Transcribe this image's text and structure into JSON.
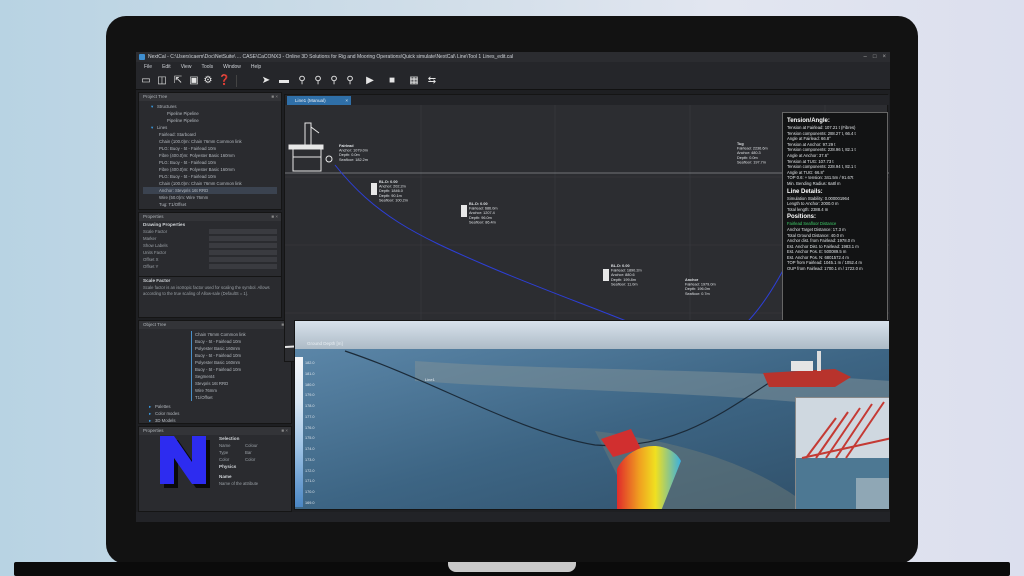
{
  "window": {
    "title": "NextCal - C:\\Users\\caem\\Doc\\NetSuite\\ ... CASE\\CaCONX3 - Online 3D Solutions for Rig and Mooring Operations\\Quick simulate\\NextCal\\ Line\\Tool 1 Lines_edit.cal",
    "controls": [
      "–",
      "□",
      "×"
    ]
  },
  "menu": [
    "File",
    "Edit",
    "View",
    "Tools",
    "Window",
    "Help"
  ],
  "toolbar_icons": [
    "new-file-icon",
    "open-file-icon",
    "import-icon",
    "export-icon",
    "settings-icon",
    "help-icon",
    "cursor-icon",
    "ruler-icon",
    "zoom-icon",
    "zoom-in-icon",
    "zoom-out-icon",
    "zoom-fit-icon",
    "play-icon",
    "stop-icon",
    "calculator-icon",
    "swap-icon"
  ],
  "project_tree": {
    "title": "Project Tree",
    "rows": [
      {
        "label": "Structures",
        "level": 1,
        "expanded": true
      },
      {
        "label": "Pipeline Pipeline",
        "level": 3
      },
      {
        "label": "Pipeline Pipeline",
        "level": 3
      },
      {
        "label": "Lines",
        "level": 1,
        "expanded": true
      },
      {
        "label": "Fairlead: Starboard",
        "level": 2
      },
      {
        "label": "Chain (100.0)m: Chain 76mm Common link",
        "level": 2
      },
      {
        "label": "PLG: Buoy - 5t - Fairlead 10m",
        "level": 2
      },
      {
        "label": "Fibre (400.0)m: Polyester Basic 160mm",
        "level": 2
      },
      {
        "label": "PLG: Buoy - 5t - Fairlead 10m",
        "level": 2
      },
      {
        "label": "Fibre (400.0)m: Polyester Basic 160mm",
        "level": 2
      },
      {
        "label": "PLG: Buoy - 5t - Fairlead 10m",
        "level": 2
      },
      {
        "label": "Chain (100.0)m: Chain 76mm Common link",
        "level": 2
      },
      {
        "label": "Anchor: Stevpris 16t RRD",
        "level": 2,
        "selected": true
      },
      {
        "label": "Wire (50.0)m: Wire 76mm",
        "level": 2
      },
      {
        "label": "Tug: T1/Offset",
        "level": 2
      }
    ]
  },
  "properties": {
    "title": "Properties",
    "section": "Drawing Properties",
    "rows": [
      "Scale Factor",
      "Marker",
      "Show Labels",
      "Units Factor",
      "Offset X",
      "Offset Y"
    ],
    "desc_title": "Scale Factor",
    "desc_text": "Scale factor is an isotropic factor used for scaling the symbol. Allows according to the true scaling of Allow-sale (DefaultS = 1)."
  },
  "object_tree": {
    "title": "Object Tree",
    "rows": [
      "Chain 76mm Common link",
      "Buoy - 5t - Fairlead 10m",
      "Polyester Basic 160mm",
      "Buoy - 5t - Fairlead 10m",
      "Polyester Basic 160mm",
      "Buoy - 5t - Fairlead 10m",
      "Segment4",
      "Stevpris 16t RRD",
      "Wire 76mm",
      "T1/Offset"
    ],
    "groups": [
      "Palettes",
      "Color modes",
      "3D Models",
      "Views"
    ]
  },
  "selection_panel": {
    "title": "Properties",
    "section": "Selection",
    "rows": [
      {
        "label": "Name",
        "value": "Colour"
      },
      {
        "label": "Type",
        "value": "Bar"
      },
      {
        "label": "Color",
        "value": "Color"
      }
    ],
    "section2": "Physics",
    "desc_title": "Name",
    "desc_text": "Name of the attribute"
  },
  "profile_view": {
    "tab_label": "Line1 (Manual)",
    "labels": {
      "fairlead": [
        "Fairlead",
        "Anchor: 1079.0m",
        "Depth: 0.0m",
        "Seafloor: 182.2m"
      ],
      "buoy1": [
        "BL.D: 0.00",
        "Anchor: 202.2m",
        "Depth: 1846.0",
        "Depth: 90.1m",
        "Seafloor: 100.2m"
      ],
      "buoy2": [
        "BL.D: 0.00",
        "Fairlead: 686.0m",
        "Anchor: 1207.4",
        "Depth: 96.0m",
        "Seafloor: 86.4m"
      ],
      "buoy3": [
        "BL.D: 0.00",
        "Fairlead: 1890.2m",
        "Anchor: 880.6",
        "Depth: 199.8m",
        "Seafloor: 11.0m"
      ],
      "anchor": [
        "Anchor",
        "Fairlead: 1979.0m",
        "Depth: 196.0m",
        "Seafloor: 0.7m"
      ],
      "tug": [
        "Tug",
        "Fairlead: 2236.6m",
        "Anchor: 480.3",
        "Depth: 0.0m",
        "Seafloor: 197.7m"
      ],
      "anchor_marker": "Anchor",
      "pipeline_marker": "Pipeline"
    }
  },
  "info_panel": {
    "title1": "Tension/Angle:",
    "rows1": [
      "Tension at Fairlead: 107.21 t (Fibres)",
      "Tension components: 288.27 t, 66.4 t",
      "Angle at Fairlead: 66.8°",
      "Tension at Anchor: 97.29 t",
      "Tension components: 228.96 t, 82.1 t",
      "Angle at Anchor: 37.6°",
      "Tension at TUG: 107.73 t",
      "Tension components: 228.94 t, 82.1 t",
      "Angle at TUG: 66.8°",
      "TOP 0.6: + tension: 341.5m / 91.67t",
      "Min. Bending Radius: 6a8l m"
    ],
    "title2": "Line Details:",
    "rows2": [
      "Simulation Stability: 0.000001964",
      "Length to Anchor: 2000.0 m",
      "Total length: 2388.4 m"
    ],
    "title3": "Positions:",
    "rows3": [
      "Fairlead Seafloor Distance",
      "Anchor Target Distance: 17.3 m",
      "Total Ground Distance: 40.0 m",
      "Anchor dist. from Fairlead: 1978.0 m",
      "Est. Anchor Dist. to Fairlead: 1983.1 m",
      "Est. Anchor Pos. E: 500089.5 m",
      "Est. Anchor Pos. N: 6801572.4 m",
      "TOP from Fairlead: 1045.1 m / 1052.4 m",
      "OUP from Fairlead: 1700.1 m / 1722.0 m"
    ]
  },
  "view3d": {
    "legend_title": "Ground Depth [m]",
    "legend_ticks": [
      "182.0",
      "181.0",
      "180.0",
      "179.0",
      "178.0",
      "177.0",
      "176.0",
      "175.0",
      "174.0",
      "173.0",
      "172.0",
      "171.0",
      "170.0",
      "169.0"
    ],
    "line_label": "Line1"
  },
  "colors": {
    "accent": "#2f6fa8",
    "mooring_line": "#2d3fd8",
    "marker_red": "#e6141c",
    "logo_blue": "#2d2cf0",
    "logo_black": "#0a0a0a"
  },
  "logo_letter": "N"
}
